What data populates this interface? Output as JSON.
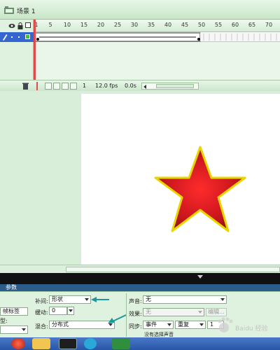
{
  "scene": {
    "label": "场景 1"
  },
  "timeline": {
    "ruler_labels": [
      "1",
      "5",
      "10",
      "15",
      "20",
      "25",
      "30",
      "35",
      "40",
      "45",
      "50",
      "55",
      "60",
      "65",
      "70"
    ],
    "status": {
      "frame": "1",
      "fps": "12.0 fps",
      "time": "0.0s"
    }
  },
  "props": {
    "tab": "参数",
    "tween_label": "补间:",
    "tween_value": "形状",
    "ease_label": "缓动:",
    "ease_value": "0",
    "blend_label": "混合:",
    "blend_value": "分布式",
    "sound_label": "声音:",
    "sound_value": "无",
    "effect_label": "效果:",
    "effect_value": "无",
    "edit_button": "编辑...",
    "sync_label": "同步:",
    "sync_value": "事件",
    "repeat_value": "重复",
    "repeat_count": "1",
    "no_sound_text": "没有选择声音",
    "left_cut_label_1": "帧标签",
    "left_cut_label_2": "型:"
  },
  "colors": {
    "star_fill": "#c8161d",
    "star_outline": "#e8d600",
    "arrow": "#1a9a9a"
  },
  "watermark": "Baidu 经验"
}
